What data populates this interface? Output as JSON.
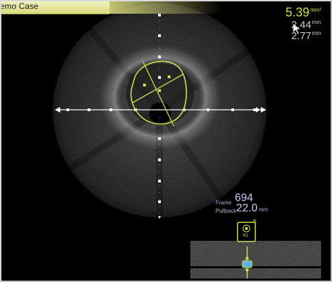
{
  "header": {
    "case_title": "emo Case"
  },
  "measurements": {
    "area": {
      "value": "5.39",
      "unit": "mm²"
    },
    "diameter_1": {
      "value": "2.44",
      "unit": "mm"
    },
    "diameter_2": {
      "value": "2.77",
      "unit": "mm"
    }
  },
  "frame_info": {
    "frame_label": "Frame",
    "frame_value": "694",
    "pullback_label": "Pullback",
    "pullback_value": "22.0",
    "pullback_unit": "mm"
  },
  "marker": {
    "label": "R1",
    "close_glyph": "×"
  },
  "colors": {
    "accent": "#cde24b",
    "banner": "#e4e79a",
    "scale_markers": "#ffffff",
    "info_text": "#c6cff2"
  },
  "icons": [
    "cursor-icon",
    "close-icon",
    "vessel-icon",
    "arrow-left-icon",
    "arrow-right-icon"
  ]
}
